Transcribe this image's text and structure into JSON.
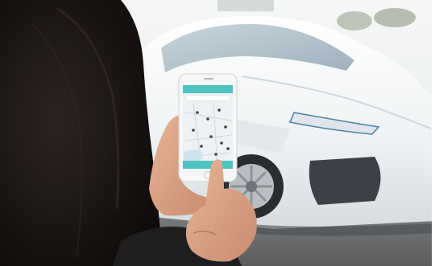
{
  "scene": {
    "description_free": true,
    "colors": {
      "page_background": "#ffffff",
      "sky": "#e9eef0",
      "car_body": "#f3f5f6",
      "car_shadow": "#c9d0d4",
      "window_glass": "#b8c6cf",
      "headlight_accent": "#4c7fa6",
      "hair": "#1b1614",
      "skin": "#d8a184",
      "jacket": "#1f1e1e",
      "asphalt": "#6c6e70",
      "phone_frame": "#f7f7f7",
      "app_header": "#4ec3c2",
      "map_background": "#eef1f3",
      "map_marker": "#3d3f44"
    },
    "icons": [
      "phone-map-app-icon"
    ]
  }
}
